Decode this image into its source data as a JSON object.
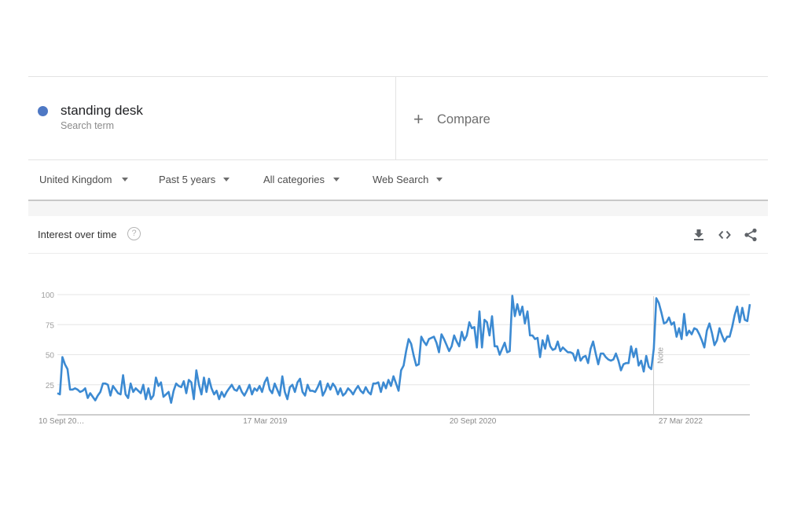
{
  "search_term": {
    "name": "standing desk",
    "subtitle": "Search term",
    "color": "#4e78c4"
  },
  "compare": {
    "icon": "plus-icon",
    "label": "Compare"
  },
  "filters": [
    {
      "label": "United Kingdom",
      "icon": "caret-down-icon"
    },
    {
      "label": "Past 5 years",
      "icon": "caret-down-icon"
    },
    {
      "label": "All categories",
      "icon": "caret-down-icon"
    },
    {
      "label": "Web Search",
      "icon": "caret-down-icon"
    }
  ],
  "card": {
    "title": "Interest over time",
    "help_icon": "?",
    "tools": [
      "download-icon",
      "embed-code-icon",
      "share-icon"
    ]
  },
  "chart_data": {
    "type": "line",
    "title": "Interest over time",
    "xlabel": "",
    "ylabel": "",
    "ylim": [
      0,
      100
    ],
    "yticks": [
      25,
      50,
      75,
      100
    ],
    "grid": true,
    "x_tick_labels": [
      "10 Sept 20…",
      "17 Mar 2019",
      "20 Sept 2020",
      "27 Mar 2022"
    ],
    "x_tick_positions": [
      0,
      0.3,
      0.6,
      0.9
    ],
    "annotation": {
      "label": "Note",
      "position": 0.861
    },
    "line_color": "#3c8ad2",
    "series": [
      {
        "name": "standing desk",
        "values": [
          18,
          17,
          48,
          42,
          38,
          21,
          21,
          22,
          21,
          19,
          20,
          22,
          14,
          18,
          15,
          12,
          16,
          19,
          26,
          26,
          25,
          16,
          24,
          21,
          18,
          17,
          33,
          17,
          14,
          26,
          19,
          22,
          20,
          18,
          25,
          13,
          22,
          13,
          16,
          31,
          24,
          27,
          15,
          17,
          19,
          10,
          20,
          26,
          24,
          23,
          28,
          18,
          29,
          27,
          13,
          37,
          25,
          17,
          31,
          19,
          30,
          22,
          17,
          20,
          13,
          19,
          15,
          19,
          22,
          25,
          21,
          20,
          24,
          19,
          16,
          20,
          25,
          17,
          22,
          20,
          24,
          19,
          27,
          31,
          21,
          18,
          26,
          21,
          16,
          32,
          19,
          13,
          23,
          25,
          19,
          27,
          30,
          19,
          16,
          25,
          20,
          20,
          19,
          23,
          28,
          16,
          20,
          26,
          21,
          26,
          23,
          17,
          22,
          16,
          18,
          22,
          20,
          17,
          21,
          24,
          20,
          18,
          23,
          19,
          17,
          26,
          26,
          27,
          19,
          27,
          22,
          29,
          24,
          32,
          26,
          20,
          37,
          41,
          53,
          63,
          59,
          49,
          41,
          42,
          65,
          61,
          58,
          63,
          64,
          65,
          60,
          52,
          67,
          63,
          58,
          53,
          57,
          66,
          61,
          57,
          69,
          62,
          66,
          77,
          72,
          73,
          56,
          86,
          56,
          79,
          77,
          66,
          82,
          57,
          57,
          50,
          55,
          60,
          52,
          53,
          99,
          82,
          92,
          83,
          90,
          76,
          86,
          66,
          66,
          63,
          64,
          48,
          62,
          55,
          66,
          57,
          54,
          55,
          61,
          53,
          56,
          54,
          52,
          52,
          51,
          45,
          54,
          45,
          48,
          49,
          43,
          55,
          61,
          51,
          42,
          51,
          51,
          48,
          46,
          45,
          46,
          51,
          45,
          37,
          42,
          43,
          43,
          57,
          48,
          55,
          41,
          45,
          36,
          49,
          40,
          38,
          55,
          97,
          93,
          85,
          76,
          77,
          81,
          75,
          77,
          65,
          72,
          63,
          84,
          66,
          70,
          67,
          72,
          71,
          67,
          62,
          56,
          70,
          76,
          68,
          58,
          62,
          72,
          66,
          61,
          65,
          65,
          73,
          83,
          90,
          77,
          89,
          79,
          78,
          92
        ]
      }
    ]
  }
}
